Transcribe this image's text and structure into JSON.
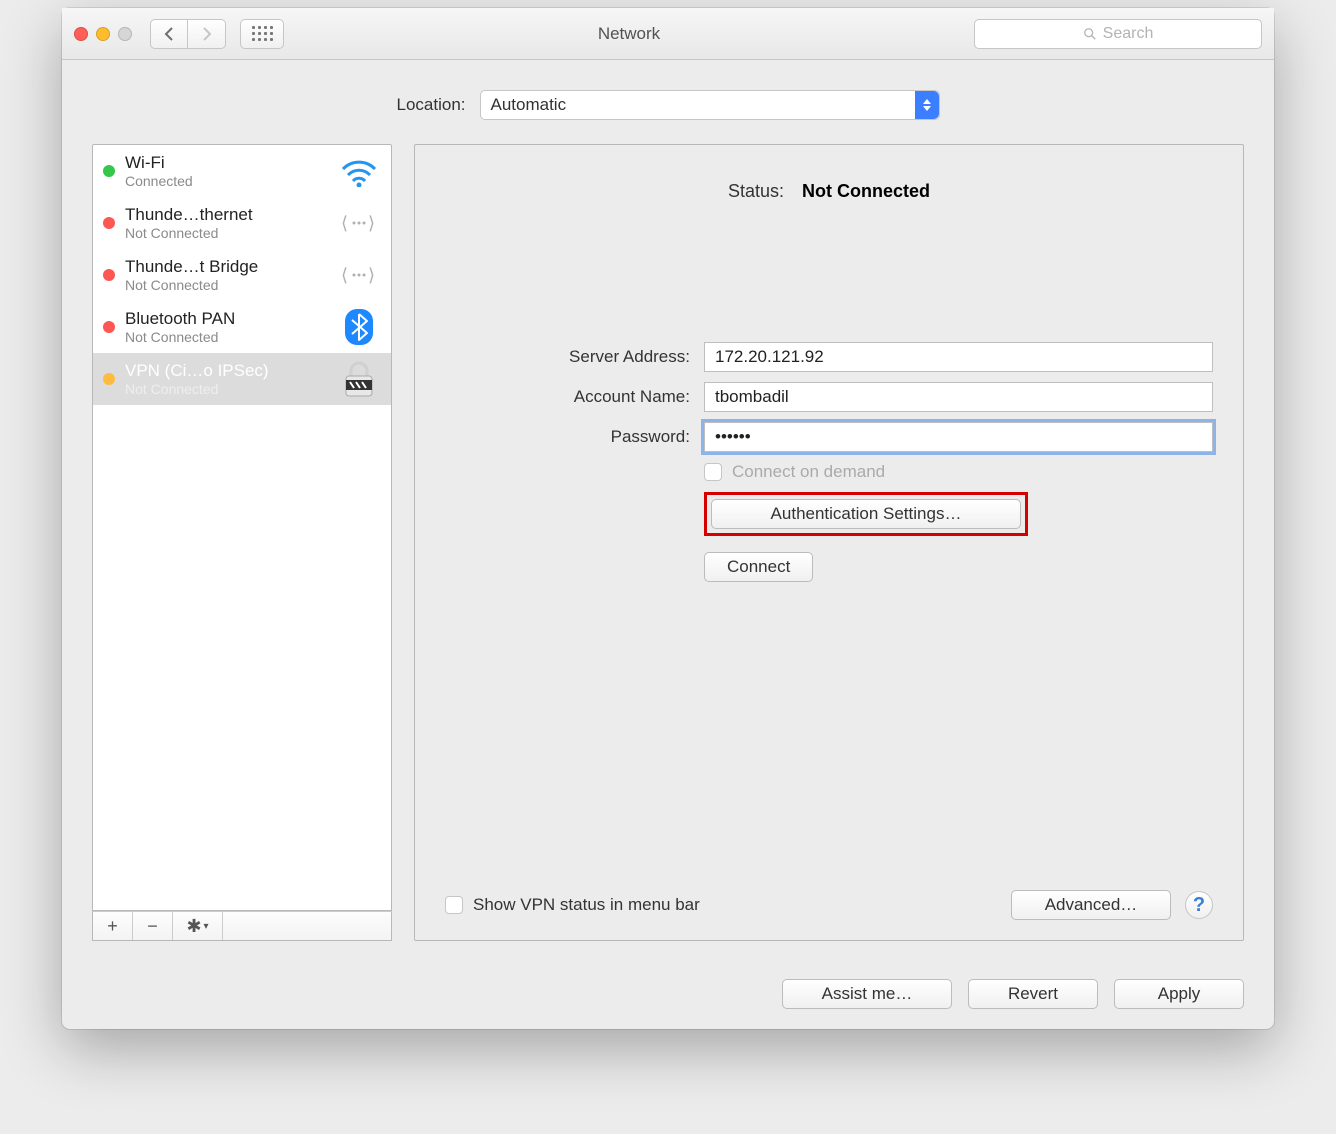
{
  "window": {
    "title": "Network",
    "search_placeholder": "Search"
  },
  "location": {
    "label": "Location:",
    "value": "Automatic"
  },
  "services": [
    {
      "name": "Wi-Fi",
      "status": "Connected",
      "dot": "green",
      "icon": "wifi"
    },
    {
      "name": "Thunde…thernet",
      "status": "Not Connected",
      "dot": "red",
      "icon": "ethernet"
    },
    {
      "name": "Thunde…t Bridge",
      "status": "Not Connected",
      "dot": "red",
      "icon": "ethernet"
    },
    {
      "name": "Bluetooth PAN",
      "status": "Not Connected",
      "dot": "red",
      "icon": "bluetooth"
    },
    {
      "name": "VPN (Ci…o IPSec)",
      "status": "Not Connected",
      "dot": "yellow",
      "icon": "lock"
    }
  ],
  "selected_service_index": 4,
  "status": {
    "label": "Status:",
    "value": "Not Connected"
  },
  "form": {
    "server_label": "Server Address:",
    "server_value": "172.20.121.92",
    "account_label": "Account Name:",
    "account_value": "tbombadil",
    "password_label": "Password:",
    "password_value": "••••••",
    "connect_on_demand": "Connect on demand",
    "auth_settings": "Authentication Settings…",
    "connect": "Connect"
  },
  "content_footer": {
    "show_vpn": "Show VPN status in menu bar",
    "advanced": "Advanced…"
  },
  "bottom": {
    "assist": "Assist me…",
    "revert": "Revert",
    "apply": "Apply"
  }
}
